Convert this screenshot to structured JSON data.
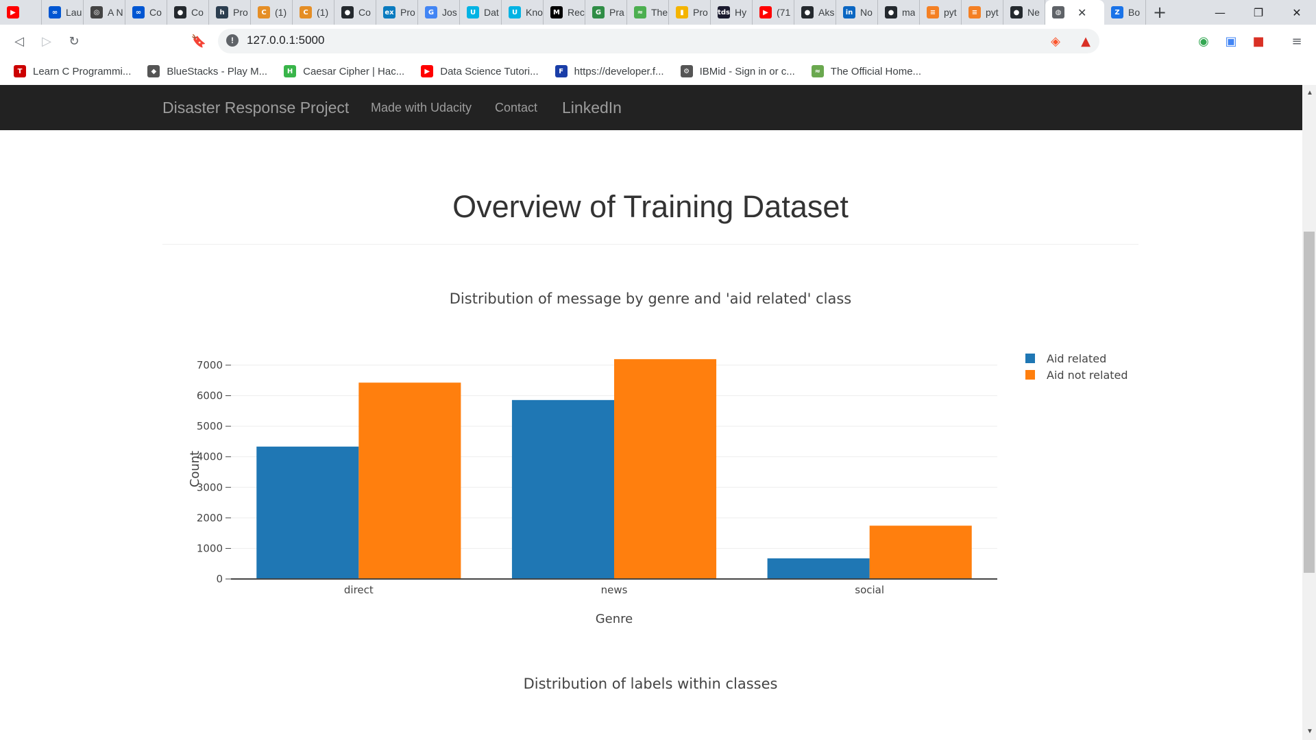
{
  "browser": {
    "tabs": [
      {
        "icon": "youtube-icon",
        "color": "#ff0000",
        "glyph": "▶",
        "label": ""
      },
      {
        "icon": "coursera-icon",
        "color": "#0056d2",
        "glyph": "∞",
        "label": "Lau"
      },
      {
        "icon": "site-icon",
        "color": "#444444",
        "glyph": "◎",
        "label": "A N"
      },
      {
        "icon": "coursera-icon",
        "color": "#0056d2",
        "glyph": "∞",
        "label": "Co"
      },
      {
        "icon": "github-icon",
        "color": "#24292e",
        "glyph": "●",
        "label": "Co"
      },
      {
        "icon": "hackerrank-icon",
        "color": "#2c3e50",
        "glyph": "h",
        "label": "Pro"
      },
      {
        "icon": "site-icon",
        "color": "#e58e26",
        "glyph": "C",
        "label": "(1)"
      },
      {
        "icon": "site-icon",
        "color": "#e58e26",
        "glyph": "C",
        "label": "(1)"
      },
      {
        "icon": "github-icon",
        "color": "#24292e",
        "glyph": "●",
        "label": "Co"
      },
      {
        "icon": "edx-icon",
        "color": "#0a7bbf",
        "glyph": "ex",
        "label": "Pro"
      },
      {
        "icon": "google-icon",
        "color": "#4285f4",
        "glyph": "G",
        "label": "Jos"
      },
      {
        "icon": "udacity-icon",
        "color": "#02b3e4",
        "glyph": "U",
        "label": "Dat"
      },
      {
        "icon": "udacity-icon",
        "color": "#02b3e4",
        "glyph": "U",
        "label": "Kno"
      },
      {
        "icon": "medium-icon",
        "color": "#000000",
        "glyph": "M",
        "label": "Rec"
      },
      {
        "icon": "geeksforgeeks-icon",
        "color": "#2f8d46",
        "glyph": "G",
        "label": "Pra"
      },
      {
        "icon": "site-icon",
        "color": "#4caf50",
        "glyph": "≈",
        "label": "The"
      },
      {
        "icon": "chart-icon",
        "color": "#f4b400",
        "glyph": "▮",
        "label": "Pro"
      },
      {
        "icon": "tds-icon",
        "color": "#1a1a2e",
        "glyph": "tds",
        "label": "Hy"
      },
      {
        "icon": "youtube-icon",
        "color": "#ff0000",
        "glyph": "▶",
        "label": "(71"
      },
      {
        "icon": "github-icon",
        "color": "#24292e",
        "glyph": "●",
        "label": "Aks"
      },
      {
        "icon": "linkedin-icon",
        "color": "#0a66c2",
        "glyph": "in",
        "label": "No"
      },
      {
        "icon": "github-icon",
        "color": "#24292e",
        "glyph": "●",
        "label": "ma"
      },
      {
        "icon": "stackoverflow-icon",
        "color": "#f48024",
        "glyph": "≡",
        "label": "pyt"
      },
      {
        "icon": "stackoverflow-icon",
        "color": "#f48024",
        "glyph": "≡",
        "label": "pyt"
      },
      {
        "icon": "github-icon",
        "color": "#24292e",
        "glyph": "●",
        "label": "Ne"
      }
    ],
    "active_tab": {
      "icon": "globe-icon",
      "color": "#5f6368",
      "glyph": "◍",
      "label": ""
    },
    "last_tab": {
      "icon": "site-icon",
      "color": "#1a73e8",
      "glyph": "Z",
      "label": "Bo"
    },
    "url": "127.0.0.1:5000",
    "bookmarks": [
      {
        "icon": "tesla-icon",
        "color": "#cc0000",
        "glyph": "T",
        "label": "Learn C Programmi..."
      },
      {
        "icon": "bluestacks-icon",
        "color": "#555555",
        "glyph": "◆",
        "label": "BlueStacks - Play M..."
      },
      {
        "icon": "hackerrank-icon",
        "color": "#39b54a",
        "glyph": "H",
        "label": "Caesar Cipher | Hac..."
      },
      {
        "icon": "youtube-icon",
        "color": "#ff0000",
        "glyph": "▶",
        "label": "Data Science Tutori..."
      },
      {
        "icon": "facebook-developer-icon",
        "color": "#1a3ea8",
        "glyph": "F",
        "label": "https://developer.f..."
      },
      {
        "icon": "ibm-icon",
        "color": "#555555",
        "glyph": "⚙",
        "label": "IBMid - Sign in or c..."
      },
      {
        "icon": "site-icon",
        "color": "#6aa84f",
        "glyph": "≈",
        "label": "The Official Home..."
      }
    ]
  },
  "navbar": {
    "brand": "Disaster Response Project",
    "links": [
      "Made with Udacity",
      "Contact",
      "LinkedIn"
    ]
  },
  "main": {
    "title": "Overview of Training Dataset",
    "chart1_title": "Distribution of message by genre and 'aid related' class",
    "chart2_title": "Distribution of labels within classes"
  },
  "chart_data": {
    "type": "bar",
    "title": "Distribution of message by genre and 'aid related' class",
    "xlabel": "Genre",
    "ylabel": "Count",
    "categories": [
      "direct",
      "news",
      "social"
    ],
    "series": [
      {
        "name": "Aid related",
        "color": "#1f77b4",
        "values": [
          4334,
          5858,
          676
        ]
      },
      {
        "name": "Aid not related",
        "color": "#ff7f0e",
        "values": [
          6428,
          7196,
          1745
        ]
      }
    ],
    "ylim": [
      0,
      7200
    ],
    "yticks": [
      0,
      1000,
      2000,
      3000,
      4000,
      5000,
      6000,
      7000
    ],
    "grid": true,
    "legend_position": "top-right"
  }
}
